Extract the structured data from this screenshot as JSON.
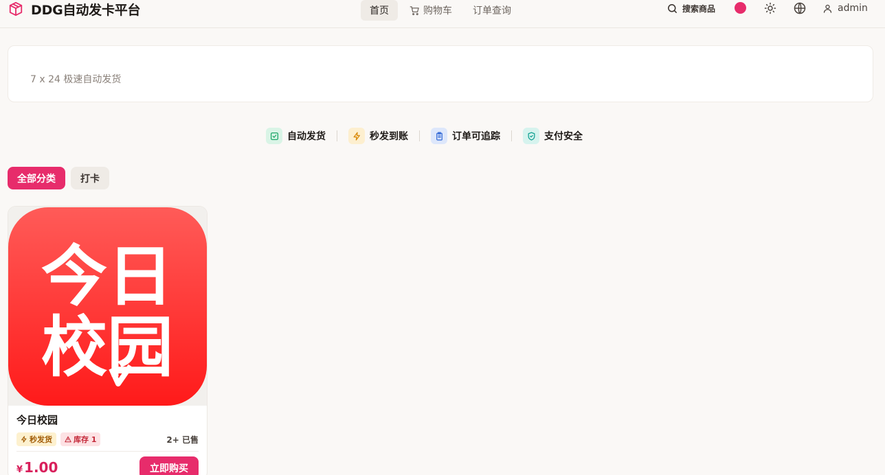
{
  "header": {
    "brand_title": "DDG自动发卡平台",
    "nav": [
      {
        "label": "首页",
        "active": true
      },
      {
        "label": "购物车",
        "icon": "cart-icon"
      },
      {
        "label": "订单查询"
      }
    ],
    "search_label": "搜索商品",
    "user_name": "admin"
  },
  "hero": {
    "subtitle": "7 x 24 极速自动发货"
  },
  "features": [
    {
      "label": "自动发货",
      "icon": "check-square-icon",
      "color": "#1fa86a",
      "bg": "#d9f4e6"
    },
    {
      "label": "秒发到账",
      "icon": "lightning-icon",
      "color": "#d98a0b",
      "bg": "#fdefcf"
    },
    {
      "label": "订单可追踪",
      "icon": "clipboard-icon",
      "color": "#3a6fd8",
      "bg": "#dde7fb"
    },
    {
      "label": "支付安全",
      "icon": "shield-icon",
      "color": "#16a294",
      "bg": "#d6f3ee"
    }
  ],
  "categories": [
    {
      "label": "全部分类",
      "active": true
    },
    {
      "label": "打卡",
      "active": false
    }
  ],
  "products": [
    {
      "name": "今日校园",
      "image_text": [
        "今日",
        "校园"
      ],
      "tag_fast": "秒发货",
      "tag_stock": "库存 1",
      "sold": "2+ 已售",
      "currency": "¥",
      "price": "1.00",
      "buy_label": "立即购买"
    }
  ],
  "colors": {
    "accent": "#e72c6b",
    "background": "#faf8f6"
  }
}
